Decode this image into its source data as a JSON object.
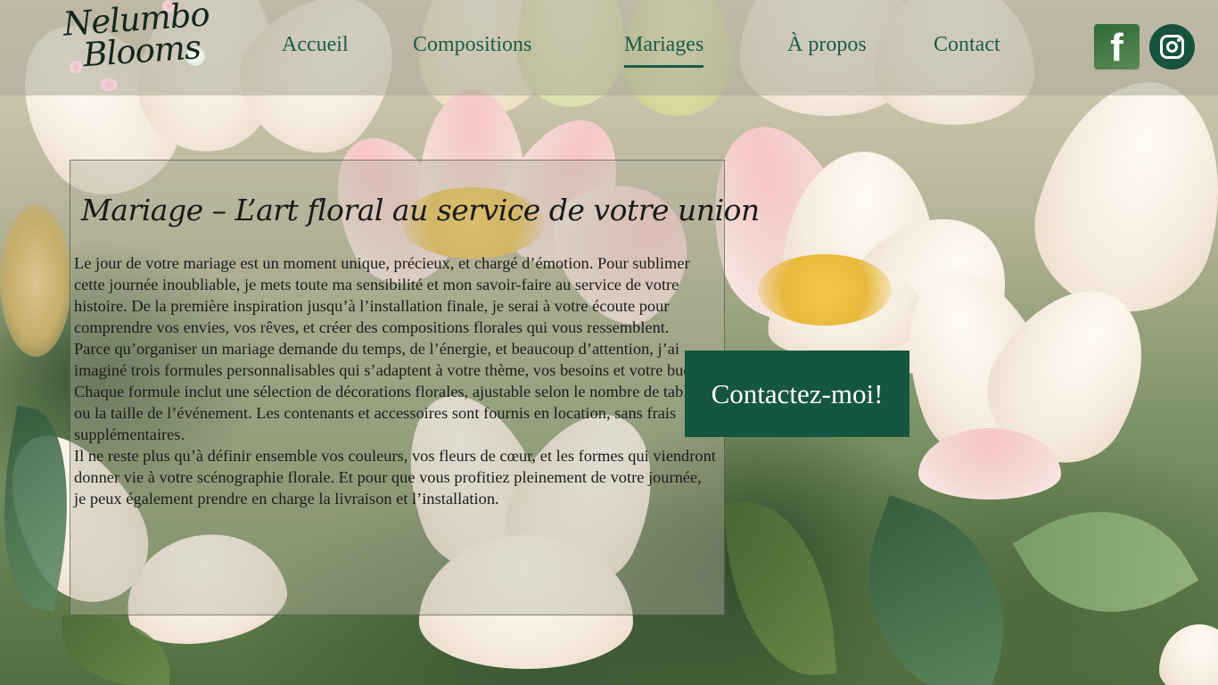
{
  "brand": {
    "name_line1": "Nelumbo",
    "name_line2": "Blooms"
  },
  "nav": {
    "items": [
      {
        "label": "Accueil"
      },
      {
        "label": "Compositions"
      },
      {
        "label": "Mariages"
      },
      {
        "label": "À propos"
      },
      {
        "label": "Contact"
      }
    ],
    "active": "Mariages"
  },
  "social": {
    "facebook_glyph": "f",
    "facebook_icon": "facebook-icon",
    "instagram_icon": "instagram-icon"
  },
  "main": {
    "title": "Mariage – L’art floral au service de votre union",
    "paragraphs": [
      "Le jour de votre mariage est un moment unique, précieux, et chargé d’émotion. Pour sublimer cette journée inoubliable, je mets toute ma sensibilité et mon savoir-faire au service de votre histoire. De la première inspiration jusqu’à l’installation finale, je serai à votre écoute pour comprendre vos envies, vos rêves, et créer des compositions florales qui vous ressemblent.",
      "Parce qu’organiser un mariage demande du temps, de l’énergie, et beaucoup d’attention, j’ai imaginé trois formules personnalisables qui s’adaptent à votre thème, vos besoins et votre budget.",
      "Chaque formule inclut une sélection de décorations florales, ajustable selon le nombre de tables ou la taille de l’événement. Les contenants et accessoires sont fournis en location, sans frais supplémentaires.",
      "Il ne reste plus qu’à définir ensemble vos couleurs, vos fleurs de cœur, et les formes qui viendront donner vie à votre scénographie florale. Et pour que vous profitiez pleinement de votre journée, je peux également prendre en charge la livraison et l’installation."
    ]
  },
  "cta": {
    "label": "Contactez-moi!"
  },
  "colors": {
    "accent": "#155640",
    "nav_text": "#1d5b45"
  }
}
